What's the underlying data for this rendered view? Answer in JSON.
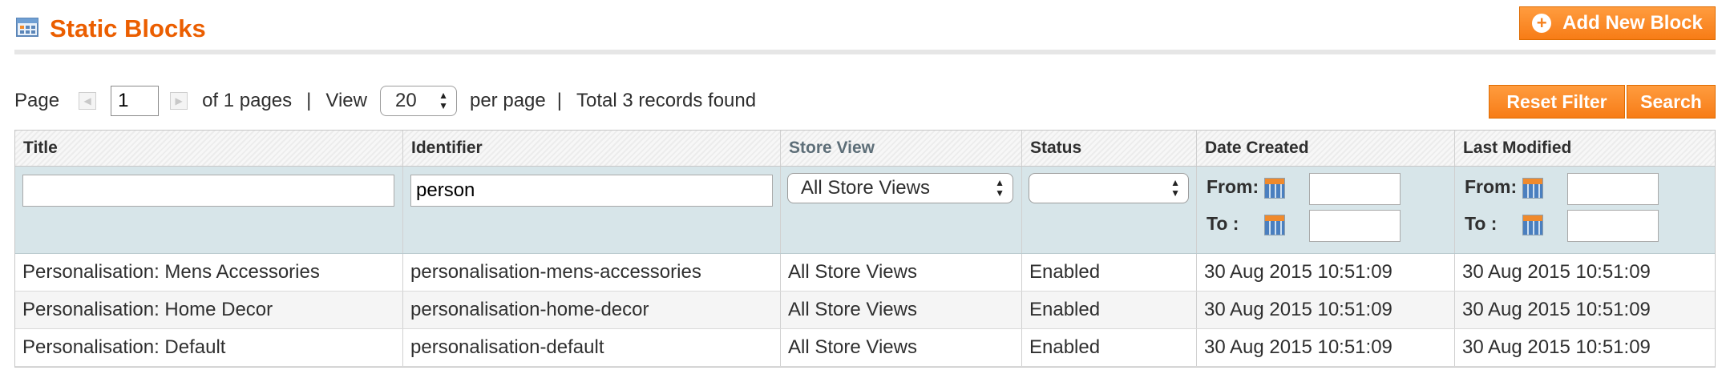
{
  "header": {
    "title": "Static Blocks",
    "icon": "grid-icon",
    "add_button_label": "Add New Block"
  },
  "pager": {
    "page_label": "Page",
    "page_value": "1",
    "of_pages": "of 1 pages",
    "view_label": "View",
    "per_page_value": "20",
    "per_page_label": "per page",
    "total": "Total 3 records found",
    "separator": "|"
  },
  "actions": {
    "reset_label": "Reset Filter",
    "search_label": "Search"
  },
  "grid": {
    "columns": [
      "Title",
      "Identifier",
      "Store View",
      "Status",
      "Date Created",
      "Last Modified"
    ],
    "filters": {
      "title_value": "",
      "identifier_value": "person",
      "store_view_value": "All Store Views",
      "status_value": "",
      "from_label": "From:",
      "to_label": "To :"
    },
    "rows": [
      [
        "Personalisation: Mens Accessories",
        "personalisation-mens-accessories",
        "All Store Views",
        "Enabled",
        "30 Aug 2015 10:51:09",
        "30 Aug 2015 10:51:09"
      ],
      [
        "Personalisation: Home Decor",
        "personalisation-home-decor",
        "All Store Views",
        "Enabled",
        "30 Aug 2015 10:51:09",
        "30 Aug 2015 10:51:09"
      ],
      [
        "Personalisation: Default",
        "personalisation-default",
        "All Store Views",
        "Enabled",
        "30 Aug 2015 10:51:09",
        "30 Aug 2015 10:51:09"
      ]
    ]
  },
  "colors": {
    "accent": "#eb5e00",
    "button": "#f77c16",
    "filter_row": "#d7e5e9"
  }
}
